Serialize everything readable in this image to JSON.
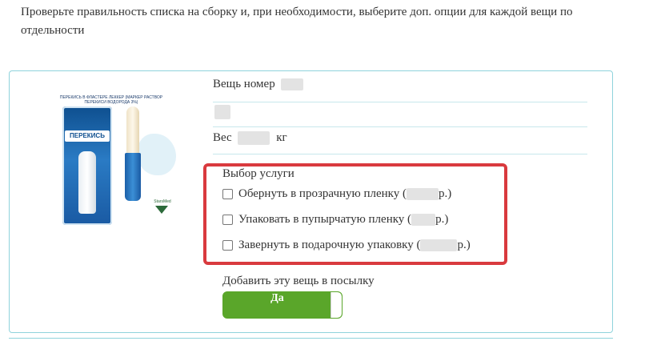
{
  "intro_text": "Проверьте правильность списка на сборку и, при необходимости, выберите доп. опции для каждой вещи по отдельности",
  "product": {
    "image_header": "ПЕРЕКИСЬ В ФЛАСТЕРЕ ЛЕККЕР (МАРКЕР РАСТВОР ПЕРЕКИСИ ВОДОРОДА 3%)",
    "image_label": "ПЕРЕКИСЬ",
    "image_brand": "StarsMed"
  },
  "item": {
    "number_label": "Вещь номер",
    "weight_label": "Вес",
    "weight_unit": "кг"
  },
  "services": {
    "title": "Выбор услуги",
    "options": [
      {
        "prefix": "Обернуть в прозрачную пленку (",
        "suffix": " р.)",
        "checked": false
      },
      {
        "prefix": "Упаковать в пупырчатую пленку (",
        "suffix": " р.)",
        "checked": false
      },
      {
        "prefix": "Завернуть в подарочную упаковку (",
        "suffix": " р.)",
        "checked": false
      }
    ]
  },
  "add_to_parcel": {
    "label": "Добавить эту вещь в посылку",
    "toggle_text": "Да",
    "toggle_on": true
  },
  "colors": {
    "accent_green": "#5aa62a",
    "highlight_red": "#d93a3e",
    "card_border": "#8fd3dc"
  }
}
